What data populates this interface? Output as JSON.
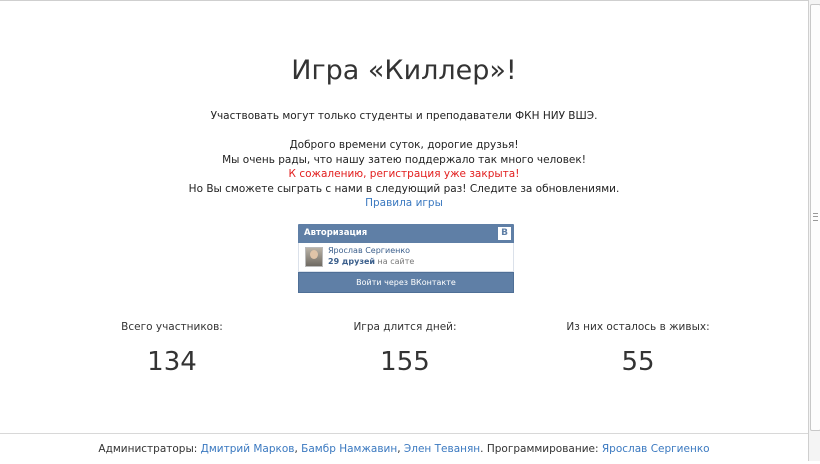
{
  "header": {
    "title": "Игра «Киллер»!"
  },
  "intro": {
    "line1": "Участвовать могут только студенты и преподаватели ФКН НИУ ВШЭ.",
    "line2": "Доброго времени суток, дорогие друзья!",
    "line3": "Мы очень рады, что нашу затею поддержало так много человек!",
    "line4": "К сожалению, регистрация уже закрыта!",
    "line5": "Но Вы сможете сыграть с нами в следующий раз! Следите за обновлениями.",
    "rules_link": "Правила игры"
  },
  "auth": {
    "title": "Авторизация",
    "logo": "В",
    "user_name": "Ярослав Сергиенко",
    "friends_count": "29 друзей",
    "friends_suffix": "на сайте",
    "login_button": "Войти через ВКонтакте"
  },
  "stats": [
    {
      "label": "Всего участников:",
      "value": "134"
    },
    {
      "label": "Игра длится дней:",
      "value": "155"
    },
    {
      "label": "Из них осталось в живых:",
      "value": "55"
    }
  ],
  "footer": {
    "admins_label": "Администраторы:",
    "admin1": "Дмитрий Марков",
    "admin2": "Бамбр Намжавин",
    "admin3": "Элен Теванян",
    "prog_label": "Программирование:",
    "programmer": "Ярослав Сергиенко"
  },
  "colors": {
    "link": "#3b79c0",
    "warning": "#e21d1d",
    "vk_blue": "#5f7fa6"
  }
}
